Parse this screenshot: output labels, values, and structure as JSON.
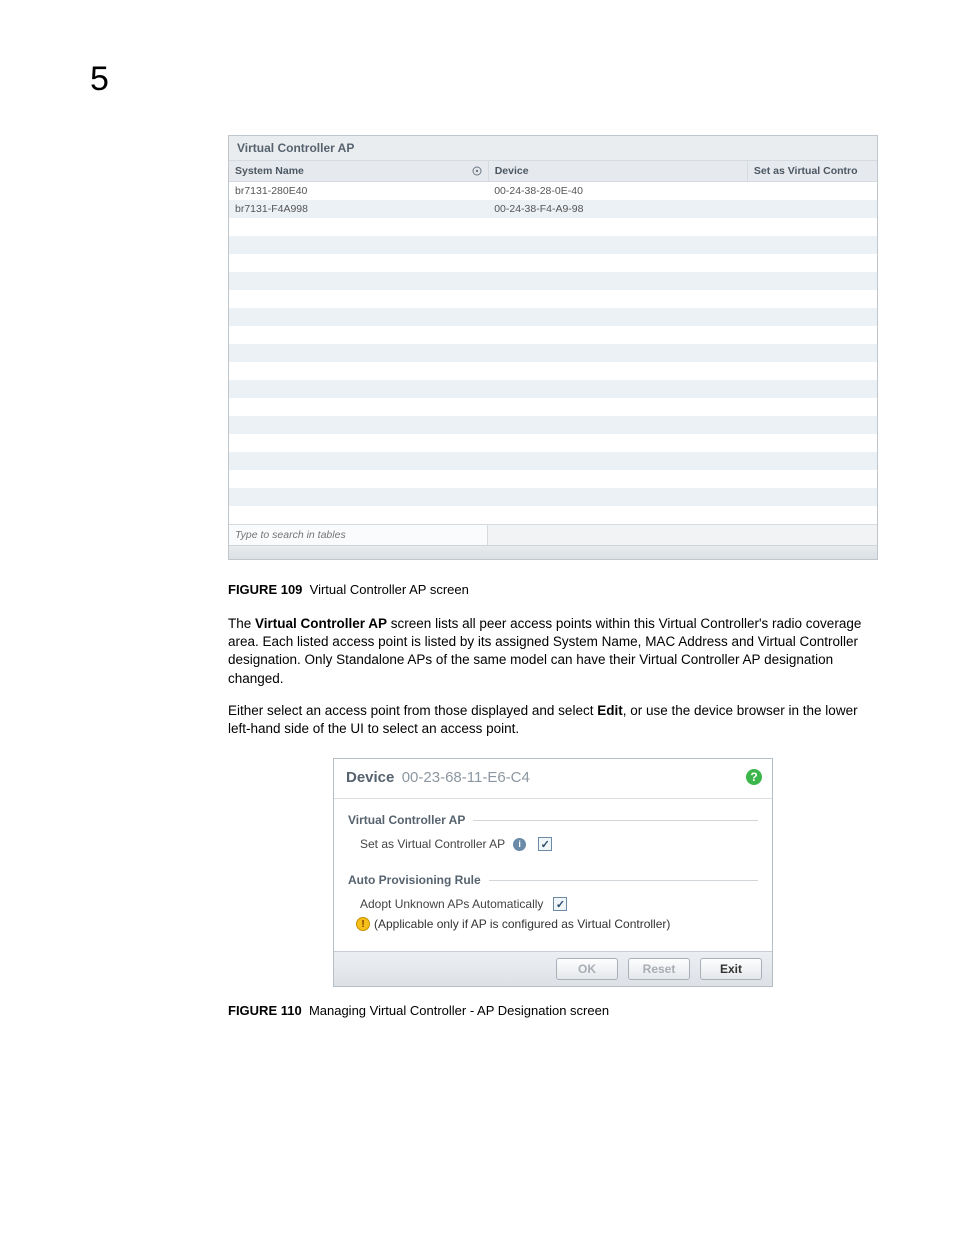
{
  "page_number": "5",
  "panel1": {
    "title": "Virtual Controller AP",
    "headers": {
      "system_name": "System Name",
      "device": "Device",
      "set_as": "Set as Virtual Contro"
    },
    "rows": [
      {
        "system_name": "br7131-280E40",
        "device": "00-24-38-28-0E-40",
        "set_as": ""
      },
      {
        "system_name": "br7131-F4A998",
        "device": "00-24-38-F4-A9-98",
        "set_as": ""
      }
    ],
    "empty_rows": 17,
    "search_placeholder": "Type to search in tables"
  },
  "caption1": {
    "label": "FIGURE 109",
    "text": "Virtual Controller AP screen"
  },
  "para1": {
    "lead": "The ",
    "bold1": "Virtual Controller AP",
    "rest": " screen lists all peer access points within this Virtual Controller's radio coverage area. Each listed access point is listed by its assigned System Name, MAC Address and Virtual Controller designation. Only Standalone APs of the same model can have their Virtual Controller AP designation changed."
  },
  "para2": {
    "lead": "Either select an access point from those displayed and select ",
    "bold1": "Edit",
    "rest": ", or use the device browser in the lower left-hand side of the UI to select an access point."
  },
  "dialog": {
    "device_label": "Device",
    "device_id": "00-23-68-11-E6-C4",
    "fs1": {
      "legend": "Virtual Controller AP",
      "row_label": "Set as Virtual Controller AP"
    },
    "fs2": {
      "legend": "Auto Provisioning Rule",
      "row_label": "Adopt Unknown APs Automatically",
      "warn": "(Applicable only if AP is configured as Virtual Controller)"
    },
    "buttons": {
      "ok": "OK",
      "reset": "Reset",
      "exit": "Exit"
    }
  },
  "caption2": {
    "label": "FIGURE 110",
    "text": "Managing Virtual Controller - AP Designation screen"
  }
}
